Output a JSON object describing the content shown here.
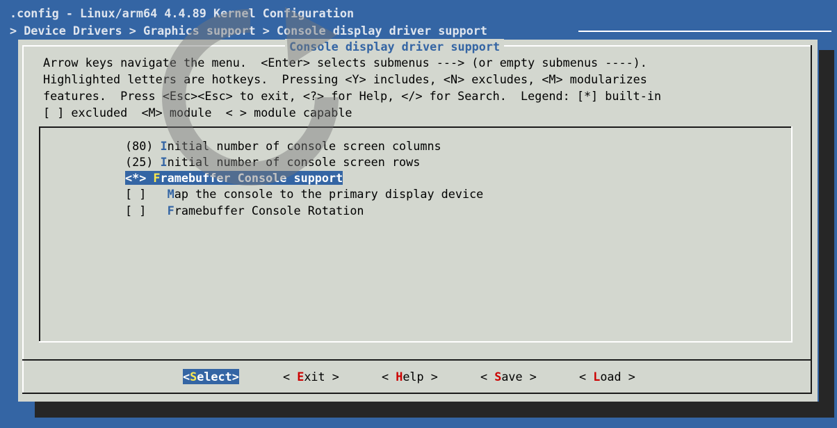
{
  "window_title": ".config - Linux/arm64 4.4.89 Kernel Configuration",
  "breadcrumb": "> Device Drivers > Graphics support > Console display driver support",
  "dialog": {
    "title": "Console display driver support",
    "help_lines": [
      "Arrow keys navigate the menu.  <Enter> selects submenus ---> (or empty submenus ----).",
      "Highlighted letters are hotkeys.  Pressing <Y> includes, <N> excludes, <M> modularizes",
      "features.  Press <Esc><Esc> to exit, <?> for Help, </> for Search.  Legend: [*] built-in",
      "[ ] excluded  <M> module  < > module capable"
    ]
  },
  "menu": {
    "items": [
      {
        "prefix": "(80) ",
        "hotkey": "I",
        "rest": "nitial number of console screen columns"
      },
      {
        "prefix": "(25) ",
        "hotkey": "I",
        "rest": "nitial number of console screen rows"
      },
      {
        "prefix": "<*> ",
        "hotkey": "F",
        "rest": "ramebuffer Console support",
        "selected": true
      },
      {
        "prefix": "[ ]   ",
        "hotkey": "M",
        "rest": "ap the console to the primary display device"
      },
      {
        "prefix": "[ ]   ",
        "hotkey": "F",
        "rest": "ramebuffer Console Rotation"
      }
    ]
  },
  "buttons": {
    "select": {
      "open": "<",
      "hotkey": "S",
      "rest": "elect>"
    },
    "exit": {
      "open": "< ",
      "hotkey": "E",
      "rest": "xit >"
    },
    "help": {
      "open": "< ",
      "hotkey": "H",
      "rest": "elp >"
    },
    "save": {
      "open": "< ",
      "hotkey": "S",
      "rest": "ave >"
    },
    "load": {
      "open": "< ",
      "hotkey": "L",
      "rest": "oad >"
    }
  },
  "colors": {
    "background": "#3465a4",
    "dialog": "#d3d7cf",
    "hotkey": "#3465a4",
    "button_hotkey": "#cc0000",
    "selected_hotkey": "#fce94f"
  }
}
